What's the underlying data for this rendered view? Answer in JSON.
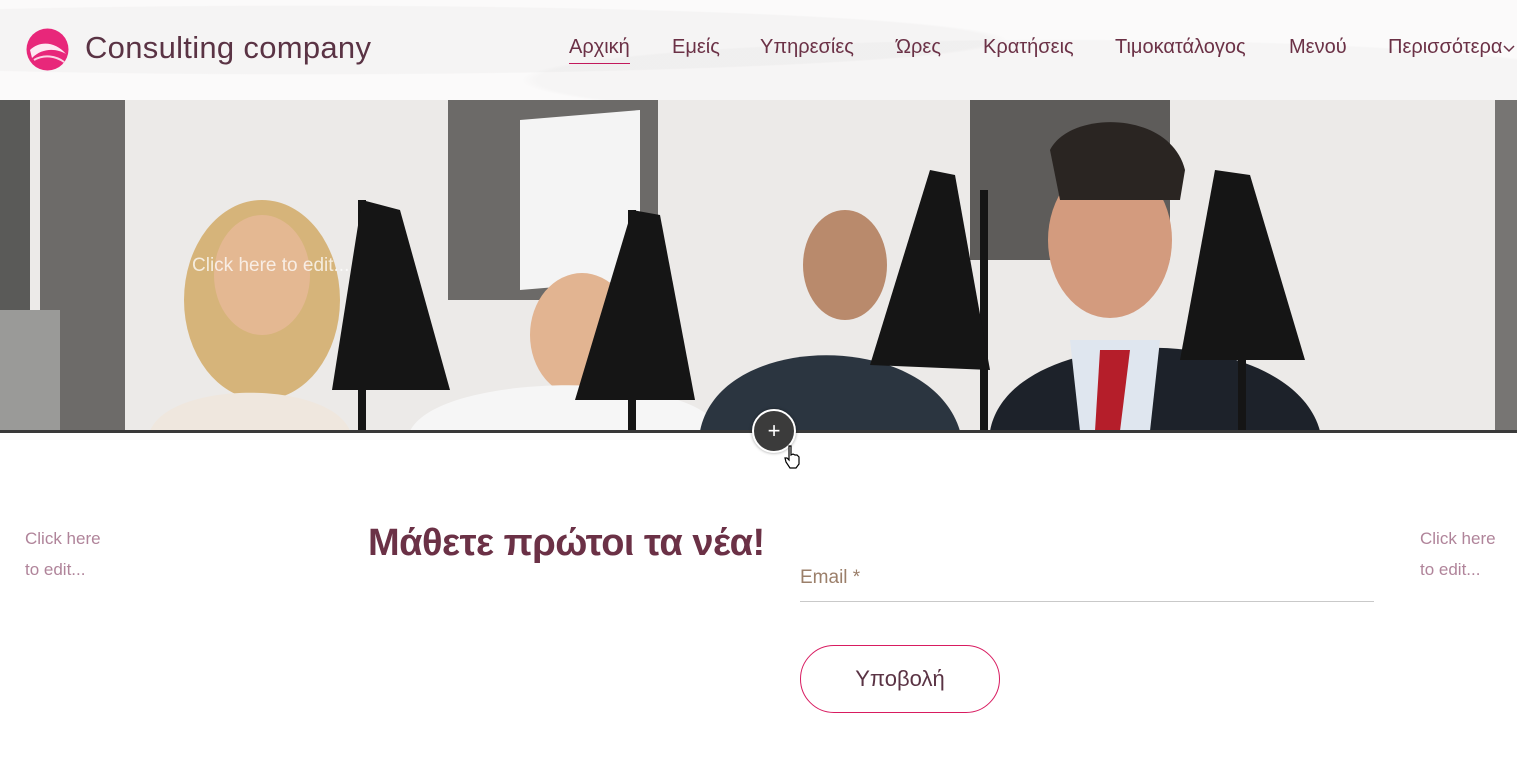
{
  "header": {
    "brand": "Consulting company",
    "nav": [
      {
        "label": "Αρχική",
        "active": true
      },
      {
        "label": "Εμείς",
        "active": false
      },
      {
        "label": "Υπηρεσίες",
        "active": false
      },
      {
        "label": "Ώρες",
        "active": false
      },
      {
        "label": "Κρατήσεις",
        "active": false
      },
      {
        "label": "Τιμοκατάλογος",
        "active": false
      },
      {
        "label": "Μενού",
        "active": false
      },
      {
        "label": "Περισσότερα",
        "active": false
      }
    ]
  },
  "hero": {
    "edit_text": "Click here to edit..."
  },
  "newsletter": {
    "left_edit": [
      "Click here",
      "to edit..."
    ],
    "right_edit": [
      "Click here",
      "to edit..."
    ],
    "headline": "Μάθετε πρώτοι τα νέα!",
    "email_label": "Email *",
    "submit_label": "Υποβολή"
  },
  "colors": {
    "accent": "#d81b60",
    "text_primary": "#6b3146"
  },
  "icons": {
    "logo": "brand-logo-icon",
    "more": "chevron-down-icon",
    "add": "plus-icon",
    "cursor": "hand-pointer-icon"
  }
}
